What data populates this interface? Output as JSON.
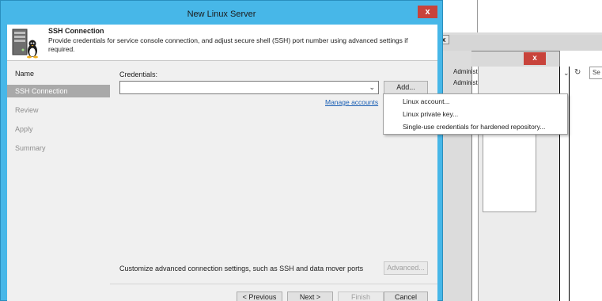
{
  "dialog": {
    "title": "New Linux Server",
    "close_glyph": "x",
    "header": {
      "title": "SSH Connection",
      "description": "Provide credentials for service console connection, and adjust secure shell (SSH) port number using advanced settings if required.",
      "icon": "linux-server-icon"
    }
  },
  "steps": [
    {
      "label": "Name",
      "state": "done"
    },
    {
      "label": "SSH Connection",
      "state": "active"
    },
    {
      "label": "Review",
      "state": "pending"
    },
    {
      "label": "Apply",
      "state": "pending"
    },
    {
      "label": "Summary",
      "state": "pending"
    }
  ],
  "credentials": {
    "label": "Credentials:",
    "selected_value": "",
    "dropdown_arrow": "⌄",
    "add_button": "Add...",
    "manage_link": "Manage accounts"
  },
  "add_menu": {
    "items": [
      "Linux account...",
      "Linux private key...",
      "Single-use credentials for hardened repository..."
    ]
  },
  "advanced": {
    "text": "Customize advanced connection settings, such as SSH and data mover ports",
    "button": "Advanced..."
  },
  "footer": {
    "previous": "< Previous",
    "next": "Next >",
    "finish": "Finish",
    "cancel": "Cancel"
  },
  "background": {
    "admin_text_1": "Administ",
    "admin_text_2": "Administ",
    "close_glyph": "x",
    "search_text": "Se",
    "refresh_glyph": "↻",
    "dropdown_glyph": "⌄"
  },
  "colors": {
    "title_bar": "#47b7e8",
    "close_button": "#c8433b",
    "active_step": "#a9a9a9",
    "link": "#1a5fb4"
  }
}
